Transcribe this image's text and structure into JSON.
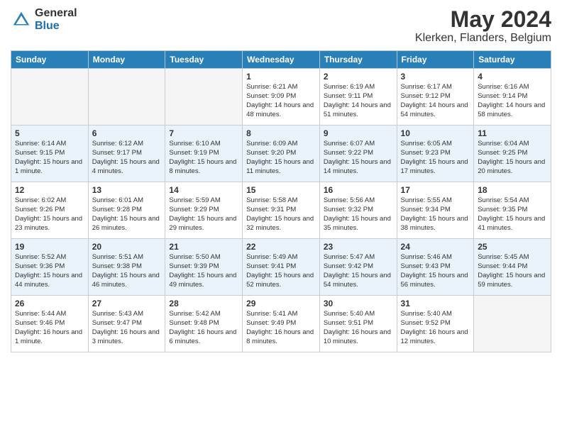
{
  "header": {
    "logo_general": "General",
    "logo_blue": "Blue",
    "month": "May 2024",
    "location": "Klerken, Flanders, Belgium"
  },
  "days_of_week": [
    "Sunday",
    "Monday",
    "Tuesday",
    "Wednesday",
    "Thursday",
    "Friday",
    "Saturday"
  ],
  "weeks": [
    {
      "shaded": false,
      "days": [
        {
          "num": "",
          "empty": true
        },
        {
          "num": "",
          "empty": true
        },
        {
          "num": "",
          "empty": true
        },
        {
          "num": "1",
          "sunrise": "Sunrise: 6:21 AM",
          "sunset": "Sunset: 9:09 PM",
          "daylight": "Daylight: 14 hours and 48 minutes."
        },
        {
          "num": "2",
          "sunrise": "Sunrise: 6:19 AM",
          "sunset": "Sunset: 9:11 PM",
          "daylight": "Daylight: 14 hours and 51 minutes."
        },
        {
          "num": "3",
          "sunrise": "Sunrise: 6:17 AM",
          "sunset": "Sunset: 9:12 PM",
          "daylight": "Daylight: 14 hours and 54 minutes."
        },
        {
          "num": "4",
          "sunrise": "Sunrise: 6:16 AM",
          "sunset": "Sunset: 9:14 PM",
          "daylight": "Daylight: 14 hours and 58 minutes."
        }
      ]
    },
    {
      "shaded": true,
      "days": [
        {
          "num": "5",
          "sunrise": "Sunrise: 6:14 AM",
          "sunset": "Sunset: 9:15 PM",
          "daylight": "Daylight: 15 hours and 1 minute."
        },
        {
          "num": "6",
          "sunrise": "Sunrise: 6:12 AM",
          "sunset": "Sunset: 9:17 PM",
          "daylight": "Daylight: 15 hours and 4 minutes."
        },
        {
          "num": "7",
          "sunrise": "Sunrise: 6:10 AM",
          "sunset": "Sunset: 9:19 PM",
          "daylight": "Daylight: 15 hours and 8 minutes."
        },
        {
          "num": "8",
          "sunrise": "Sunrise: 6:09 AM",
          "sunset": "Sunset: 9:20 PM",
          "daylight": "Daylight: 15 hours and 11 minutes."
        },
        {
          "num": "9",
          "sunrise": "Sunrise: 6:07 AM",
          "sunset": "Sunset: 9:22 PM",
          "daylight": "Daylight: 15 hours and 14 minutes."
        },
        {
          "num": "10",
          "sunrise": "Sunrise: 6:05 AM",
          "sunset": "Sunset: 9:23 PM",
          "daylight": "Daylight: 15 hours and 17 minutes."
        },
        {
          "num": "11",
          "sunrise": "Sunrise: 6:04 AM",
          "sunset": "Sunset: 9:25 PM",
          "daylight": "Daylight: 15 hours and 20 minutes."
        }
      ]
    },
    {
      "shaded": false,
      "days": [
        {
          "num": "12",
          "sunrise": "Sunrise: 6:02 AM",
          "sunset": "Sunset: 9:26 PM",
          "daylight": "Daylight: 15 hours and 23 minutes."
        },
        {
          "num": "13",
          "sunrise": "Sunrise: 6:01 AM",
          "sunset": "Sunset: 9:28 PM",
          "daylight": "Daylight: 15 hours and 26 minutes."
        },
        {
          "num": "14",
          "sunrise": "Sunrise: 5:59 AM",
          "sunset": "Sunset: 9:29 PM",
          "daylight": "Daylight: 15 hours and 29 minutes."
        },
        {
          "num": "15",
          "sunrise": "Sunrise: 5:58 AM",
          "sunset": "Sunset: 9:31 PM",
          "daylight": "Daylight: 15 hours and 32 minutes."
        },
        {
          "num": "16",
          "sunrise": "Sunrise: 5:56 AM",
          "sunset": "Sunset: 9:32 PM",
          "daylight": "Daylight: 15 hours and 35 minutes."
        },
        {
          "num": "17",
          "sunrise": "Sunrise: 5:55 AM",
          "sunset": "Sunset: 9:34 PM",
          "daylight": "Daylight: 15 hours and 38 minutes."
        },
        {
          "num": "18",
          "sunrise": "Sunrise: 5:54 AM",
          "sunset": "Sunset: 9:35 PM",
          "daylight": "Daylight: 15 hours and 41 minutes."
        }
      ]
    },
    {
      "shaded": true,
      "days": [
        {
          "num": "19",
          "sunrise": "Sunrise: 5:52 AM",
          "sunset": "Sunset: 9:36 PM",
          "daylight": "Daylight: 15 hours and 44 minutes."
        },
        {
          "num": "20",
          "sunrise": "Sunrise: 5:51 AM",
          "sunset": "Sunset: 9:38 PM",
          "daylight": "Daylight: 15 hours and 46 minutes."
        },
        {
          "num": "21",
          "sunrise": "Sunrise: 5:50 AM",
          "sunset": "Sunset: 9:39 PM",
          "daylight": "Daylight: 15 hours and 49 minutes."
        },
        {
          "num": "22",
          "sunrise": "Sunrise: 5:49 AM",
          "sunset": "Sunset: 9:41 PM",
          "daylight": "Daylight: 15 hours and 52 minutes."
        },
        {
          "num": "23",
          "sunrise": "Sunrise: 5:47 AM",
          "sunset": "Sunset: 9:42 PM",
          "daylight": "Daylight: 15 hours and 54 minutes."
        },
        {
          "num": "24",
          "sunrise": "Sunrise: 5:46 AM",
          "sunset": "Sunset: 9:43 PM",
          "daylight": "Daylight: 15 hours and 56 minutes."
        },
        {
          "num": "25",
          "sunrise": "Sunrise: 5:45 AM",
          "sunset": "Sunset: 9:44 PM",
          "daylight": "Daylight: 15 hours and 59 minutes."
        }
      ]
    },
    {
      "shaded": false,
      "days": [
        {
          "num": "26",
          "sunrise": "Sunrise: 5:44 AM",
          "sunset": "Sunset: 9:46 PM",
          "daylight": "Daylight: 16 hours and 1 minute."
        },
        {
          "num": "27",
          "sunrise": "Sunrise: 5:43 AM",
          "sunset": "Sunset: 9:47 PM",
          "daylight": "Daylight: 16 hours and 3 minutes."
        },
        {
          "num": "28",
          "sunrise": "Sunrise: 5:42 AM",
          "sunset": "Sunset: 9:48 PM",
          "daylight": "Daylight: 16 hours and 6 minutes."
        },
        {
          "num": "29",
          "sunrise": "Sunrise: 5:41 AM",
          "sunset": "Sunset: 9:49 PM",
          "daylight": "Daylight: 16 hours and 8 minutes."
        },
        {
          "num": "30",
          "sunrise": "Sunrise: 5:40 AM",
          "sunset": "Sunset: 9:51 PM",
          "daylight": "Daylight: 16 hours and 10 minutes."
        },
        {
          "num": "31",
          "sunrise": "Sunrise: 5:40 AM",
          "sunset": "Sunset: 9:52 PM",
          "daylight": "Daylight: 16 hours and 12 minutes."
        },
        {
          "num": "",
          "empty": true
        }
      ]
    }
  ]
}
